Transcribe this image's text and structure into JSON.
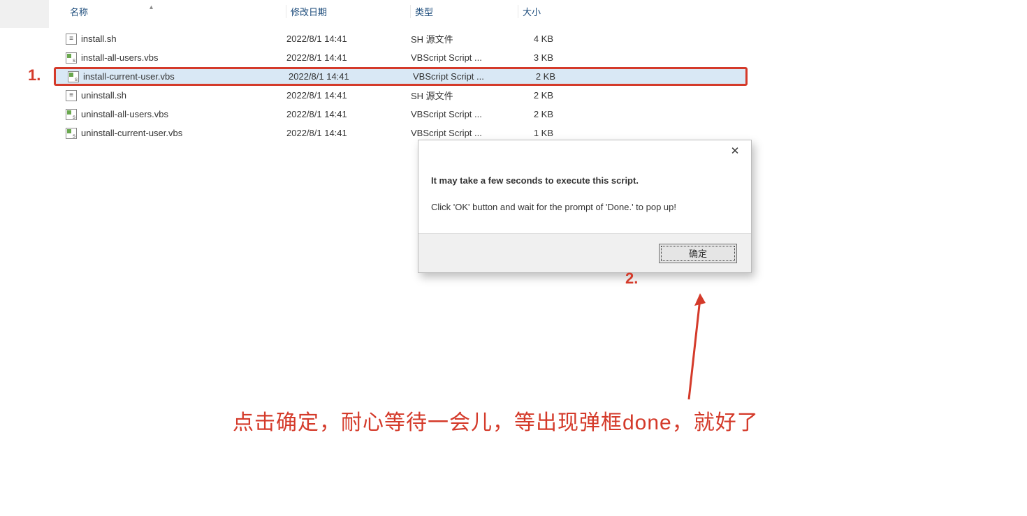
{
  "headers": {
    "name": "名称",
    "date": "修改日期",
    "type": "类型",
    "size": "大小"
  },
  "files": [
    {
      "name": "install.sh",
      "date": "2022/8/1 14:41",
      "type": "SH 源文件",
      "size": "4 KB",
      "icon": "sh",
      "highlighted": false
    },
    {
      "name": "install-all-users.vbs",
      "date": "2022/8/1 14:41",
      "type": "VBScript Script ...",
      "size": "3 KB",
      "icon": "vbs",
      "highlighted": false
    },
    {
      "name": "install-current-user.vbs",
      "date": "2022/8/1 14:41",
      "type": "VBScript Script ...",
      "size": "2 KB",
      "icon": "vbs",
      "highlighted": true
    },
    {
      "name": "uninstall.sh",
      "date": "2022/8/1 14:41",
      "type": "SH 源文件",
      "size": "2 KB",
      "icon": "sh",
      "highlighted": false
    },
    {
      "name": "uninstall-all-users.vbs",
      "date": "2022/8/1 14:41",
      "type": "VBScript Script ...",
      "size": "2 KB",
      "icon": "vbs",
      "highlighted": false
    },
    {
      "name": "uninstall-current-user.vbs",
      "date": "2022/8/1 14:41",
      "type": "VBScript Script ...",
      "size": "1 KB",
      "icon": "vbs",
      "highlighted": false
    }
  ],
  "dialog": {
    "line1": "It may take a few seconds to execute this script.",
    "line2": "Click 'OK' button and wait for the prompt of 'Done.' to pop up!",
    "ok": "确定"
  },
  "annotations": {
    "a1": "1.",
    "a2": "2.",
    "caption": "点击确定，耐心等待一会儿，等出现弹框done，就好了"
  }
}
